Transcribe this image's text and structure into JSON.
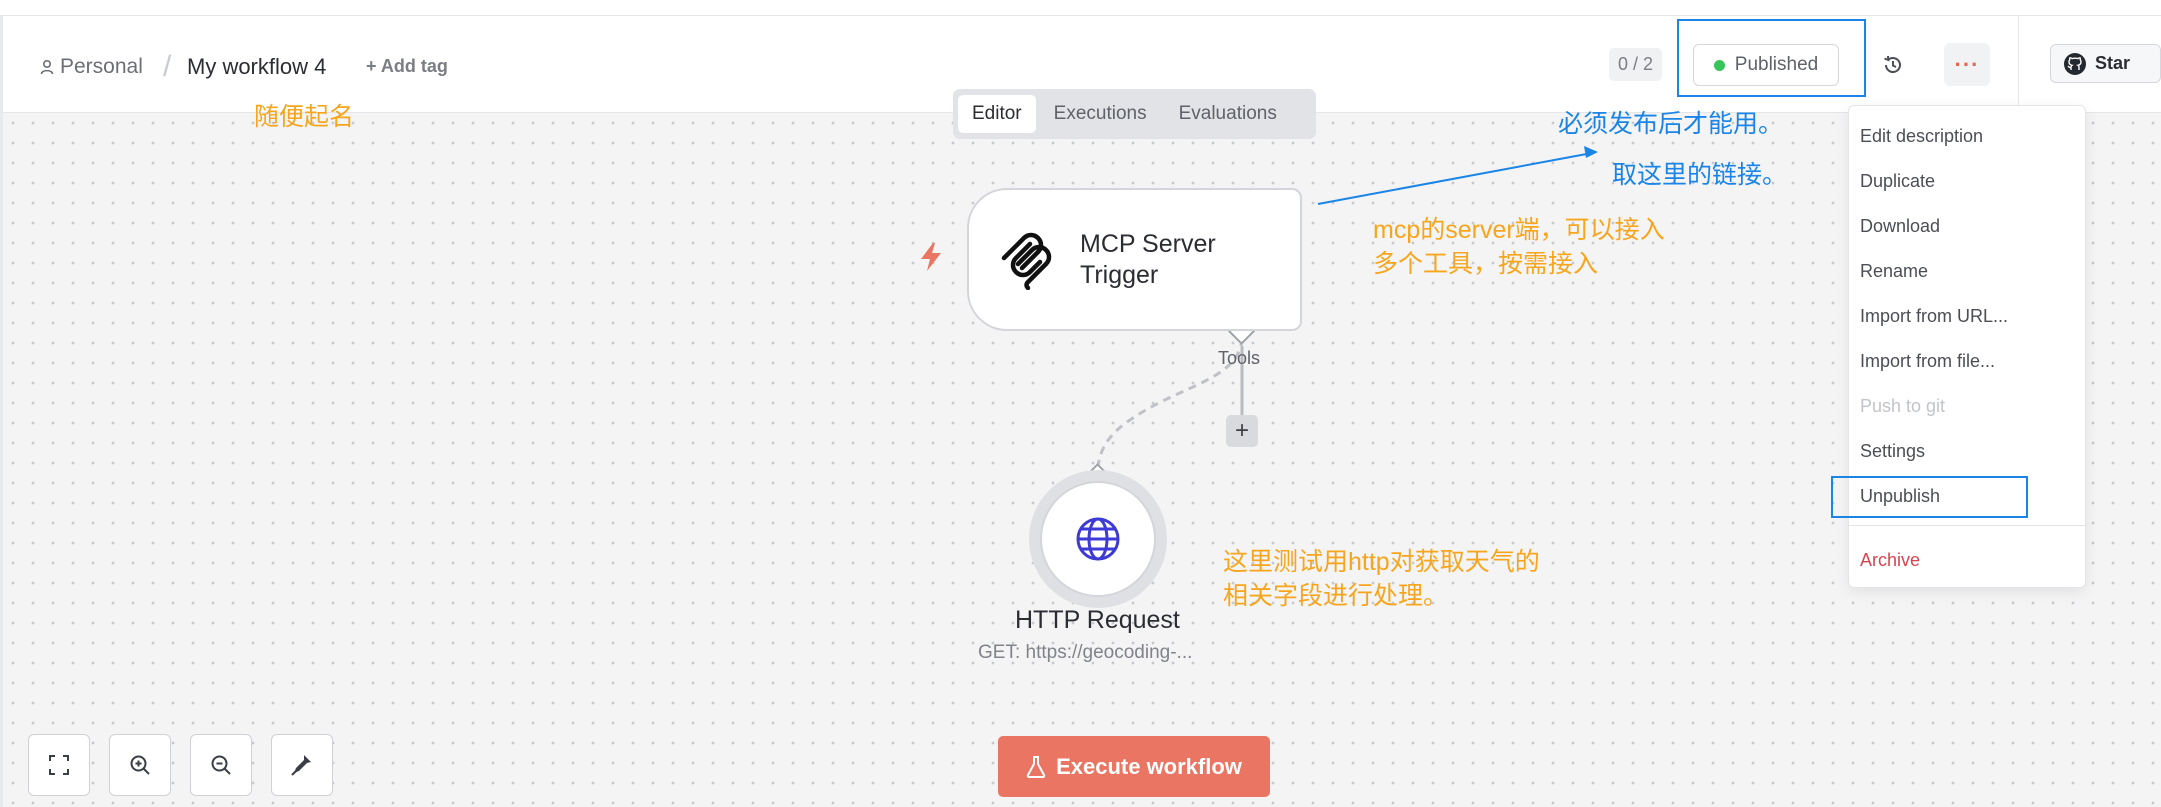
{
  "breadcrumb": {
    "owner": "Personal",
    "separator": "/",
    "workflow_name": "My workflow 4",
    "add_tag": "+ Add tag"
  },
  "header": {
    "counter": "0 / 2",
    "status": "Published",
    "more": "···",
    "github_star": "Star"
  },
  "tabs": [
    {
      "label": "Editor",
      "active": true
    },
    {
      "label": "Executions",
      "active": false
    },
    {
      "label": "Evaluations",
      "active": false
    }
  ],
  "nodes": {
    "mcp": {
      "title_line1": "MCP Server",
      "title_line2": "Trigger"
    },
    "connector_label": "Tools",
    "add_button": "+",
    "http": {
      "title": "HTTP Request",
      "subtitle": "GET: https://geocoding-..."
    }
  },
  "execute_button": "Execute workflow",
  "menu": {
    "items": [
      {
        "label": "Edit description"
      },
      {
        "label": "Duplicate"
      },
      {
        "label": "Download"
      },
      {
        "label": "Rename"
      },
      {
        "label": "Import from URL..."
      },
      {
        "label": "Import from file..."
      },
      {
        "label": "Push to git"
      },
      {
        "label": "Settings"
      },
      {
        "label": "Unpublish"
      }
    ],
    "archive": "Archive"
  },
  "annotations": {
    "name_note": "随便起名",
    "publish_note": "必须发布后才能用。",
    "link_note": "取这里的链接。",
    "mcp_note_line1": "mcp的server端，可以接入",
    "mcp_note_line2": "多个工具，按需接入",
    "http_note_line1": "这里测试用http对获取天气的",
    "http_note_line2": "相关字段进行处理。"
  },
  "colors": {
    "accent": "#ea7562",
    "annotation_orange": "#f7a51d",
    "annotation_blue": "#1a85e6",
    "published_dot": "#37c45a",
    "danger": "#d64550"
  }
}
